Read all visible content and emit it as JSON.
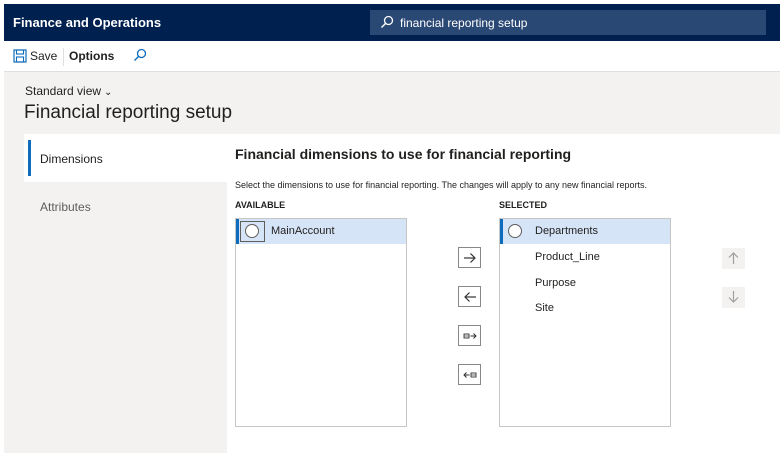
{
  "app": {
    "title": "Finance and Operations",
    "search_value": "financial reporting setup"
  },
  "actions": {
    "save_label": "Save",
    "options_label": "Options"
  },
  "page": {
    "view_label": "Standard view",
    "title": "Financial reporting setup"
  },
  "tabs": [
    {
      "label": "Dimensions",
      "active": true
    },
    {
      "label": "Attributes",
      "active": false
    }
  ],
  "section": {
    "title": "Financial dimensions to use for financial reporting",
    "description": "Select the dimensions to use for financial reporting. The changes will apply to any new financial reports.",
    "available_label": "AVAILABLE",
    "selected_label": "SELECTED"
  },
  "available": [
    "MainAccount"
  ],
  "selected": [
    "Departments",
    "Product_Line",
    "Purpose",
    "Site"
  ],
  "colors": {
    "navbar": "#002050",
    "accent": "#0f6cbd",
    "selection": "#d6e4f7"
  },
  "icons": {
    "search": "search-icon",
    "save": "save-icon",
    "move_right": "arrow-right-icon",
    "move_left": "arrow-left-icon",
    "move_all_right": "move-all-right-icon",
    "move_all_left": "move-all-left-icon",
    "move_up": "arrow-up-icon",
    "move_down": "arrow-down-icon"
  }
}
